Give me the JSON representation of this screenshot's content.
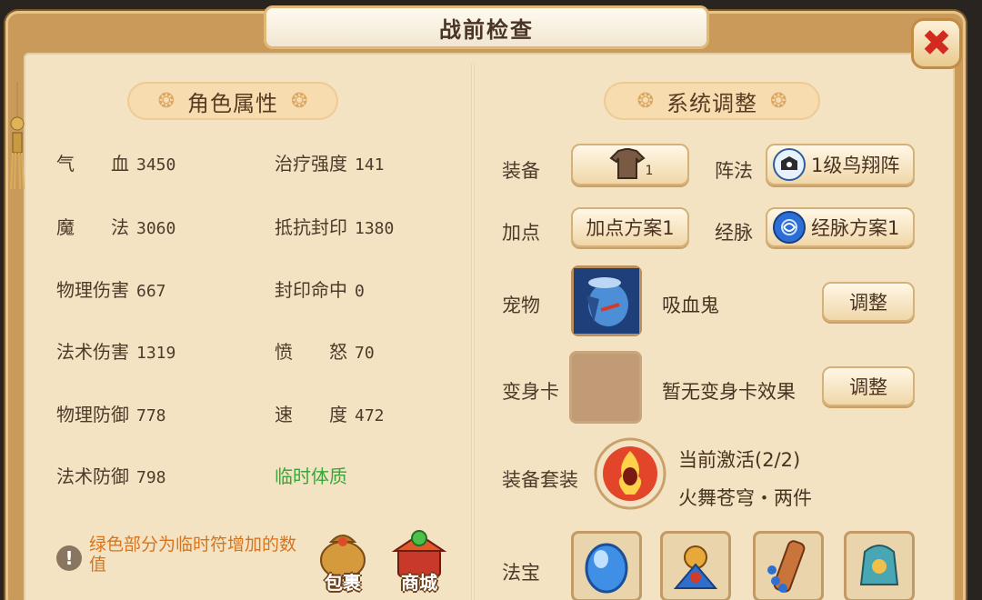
{
  "header": {
    "title": "战前检查"
  },
  "left": {
    "section_title": "角色属性",
    "attributes": [
      {
        "label": "气　　血",
        "value": "3450"
      },
      {
        "label": "治疗强度",
        "value": "141"
      },
      {
        "label": "魔　　法",
        "value": "3060"
      },
      {
        "label": "抵抗封印",
        "value": "1380"
      },
      {
        "label": "物理伤害",
        "value": "667"
      },
      {
        "label": "封印命中",
        "value": "0"
      },
      {
        "label": "法术伤害",
        "value": "1319"
      },
      {
        "label": "愤　　怒",
        "value": "70"
      },
      {
        "label": "物理防御",
        "value": "778"
      },
      {
        "label": "速　　度",
        "value": "472"
      },
      {
        "label": "法术防御",
        "value": "798"
      }
    ],
    "temp_constitution": "临时体质",
    "note": "绿色部分为临时符增加的数值",
    "bag_label": "包裹",
    "shop_label": "商城"
  },
  "right": {
    "section_title": "系统调整",
    "equip_label": "装备",
    "equip_count": "1",
    "formation_label": "阵法",
    "formation_value": "1级鸟翔阵",
    "points_label": "加点",
    "points_value": "加点方案1",
    "meridian_label": "经脉",
    "meridian_value": "经脉方案1",
    "pet_label": "宠物",
    "pet_name": "吸血鬼",
    "adjust_label": "调整",
    "card_label": "变身卡",
    "card_status": "暂无变身卡效果",
    "set_label": "装备套装",
    "set_active": "当前激活(2/2)",
    "set_name": "火舞苍穹・两件",
    "treasure_label": "法宝"
  },
  "colors": {
    "accent_green": "#3aa63a",
    "note_orange": "#d8741e",
    "close_red": "#d22a1e"
  }
}
